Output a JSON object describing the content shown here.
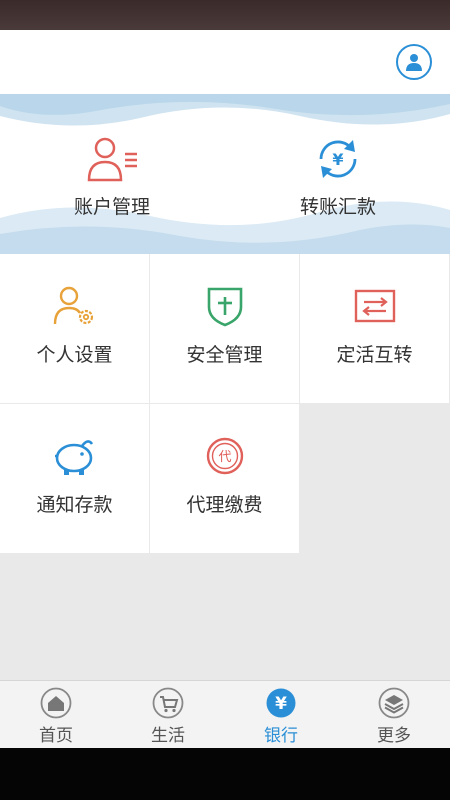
{
  "header": {
    "avatar_icon": "user-icon"
  },
  "banner": {
    "items": [
      {
        "label": "账户管理",
        "icon": "account-icon",
        "color": "#e0605a"
      },
      {
        "label": "转账汇款",
        "icon": "transfer-icon",
        "color": "#2a8fd6"
      }
    ]
  },
  "grid": {
    "items": [
      {
        "label": "个人设置",
        "icon": "person-settings-icon",
        "color": "#e8a23a"
      },
      {
        "label": "安全管理",
        "icon": "shield-icon",
        "color": "#3aa56a"
      },
      {
        "label": "定活互转",
        "icon": "exchange-icon",
        "color": "#e0605a"
      },
      {
        "label": "通知存款",
        "icon": "piggy-bank-icon",
        "color": "#2a8fd6"
      },
      {
        "label": "代理缴费",
        "icon": "agent-pay-icon",
        "color": "#e0605a"
      }
    ]
  },
  "tabbar": {
    "tabs": [
      {
        "label": "首页",
        "icon": "home-icon"
      },
      {
        "label": "生活",
        "icon": "cart-icon"
      },
      {
        "label": "银行",
        "icon": "yuan-icon",
        "active": true
      },
      {
        "label": "更多",
        "icon": "layers-icon"
      }
    ],
    "accent": "#2a8fd6"
  }
}
